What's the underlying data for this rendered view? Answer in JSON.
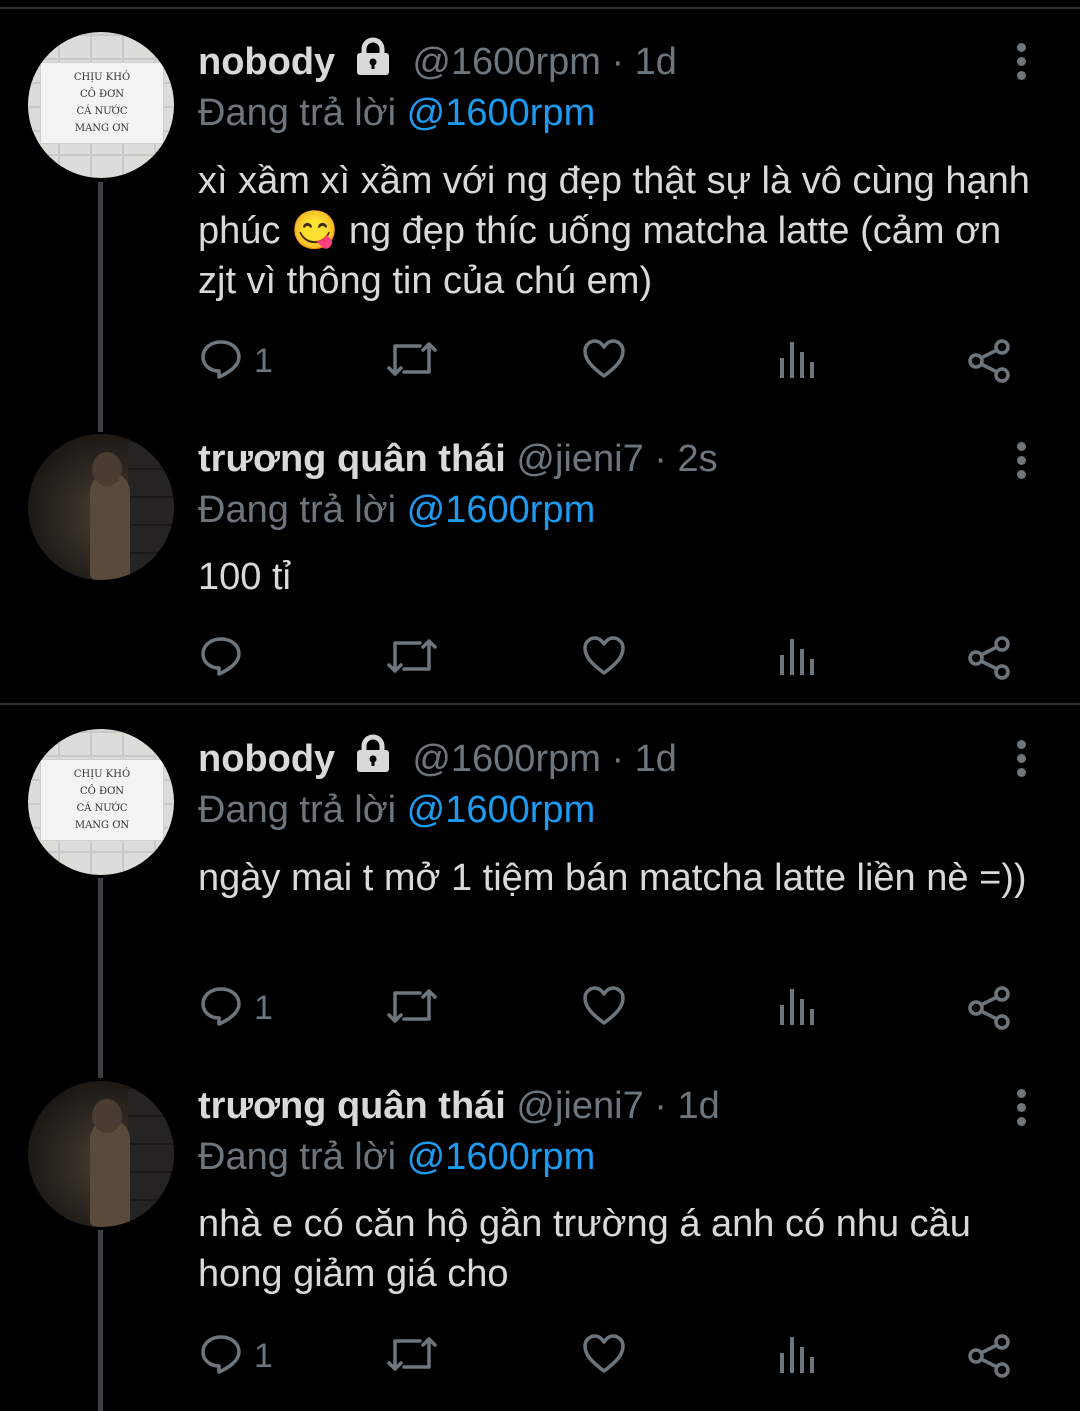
{
  "tweets": [
    {
      "name": "nobody",
      "handle": "@1600rpm",
      "time": "· 1d",
      "replying_prefix": "Đang trả lời",
      "replying_to": "@1600rpm",
      "text": "xì xầm xì xầm với ng đẹp thật sự là vô cùng hạnh phúc 😋 ng đẹp thíc uống matcha latte (cảm ơn zjt vì thông tin của chú em)",
      "reply_count": "1",
      "avatar_sign": [
        "CHỊU KHÓ",
        "CÔ ĐƠN",
        "CÁ NƯỚC",
        "MANG ƠN"
      ]
    },
    {
      "name": "trương quân thái",
      "handle": "@jieni7",
      "time": "· 2s",
      "replying_prefix": "Đang trả lời",
      "replying_to": "@1600rpm",
      "text": "100 tỉ",
      "reply_count": ""
    },
    {
      "name": "nobody",
      "handle": "@1600rpm",
      "time": "· 1d",
      "replying_prefix": "Đang trả lời",
      "replying_to": "@1600rpm",
      "text": "ngày mai t mở 1 tiệm bán matcha latte liền nè =))",
      "reply_count": "1",
      "avatar_sign": [
        "CHỊU KHÓ",
        "CÔ ĐƠN",
        "CÁ NƯỚC",
        "MANG ƠN"
      ]
    },
    {
      "name": "trương quân thái",
      "handle": "@jieni7",
      "time": "· 1d",
      "replying_prefix": "Đang trả lời",
      "replying_to": "@1600rpm",
      "text": "nhà e có căn hộ gần trường á anh có nhu cầu hong giảm giá cho",
      "reply_count": "1"
    }
  ],
  "icons": {
    "reply": "reply-icon",
    "retweet": "retweet-icon",
    "like": "heart-icon",
    "stats": "analytics-icon",
    "share": "share-icon",
    "lock": "lock-icon",
    "more": "more-vertical-icon"
  },
  "colors": {
    "background": "#000000",
    "text": "#d9d9d9",
    "muted": "#6e767d",
    "mention": "#1d9bf0",
    "divider": "#2f3336"
  }
}
